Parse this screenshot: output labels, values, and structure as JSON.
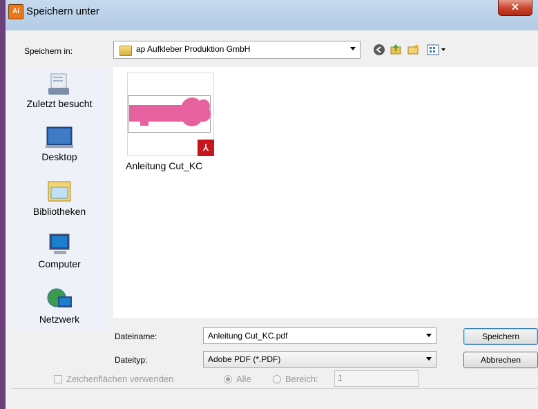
{
  "window": {
    "title": "Speichern unter",
    "app_icon_text": "Ai",
    "close_glyph": "✕"
  },
  "location": {
    "label": "Speichern in:",
    "value": "ap Aufkleber Produktion GmbH"
  },
  "toolbar": {
    "icons": [
      "back-icon",
      "up-folder-icon",
      "new-folder-icon",
      "view-menu-icon"
    ]
  },
  "places": [
    {
      "label": "Zuletzt besucht",
      "icon": "recent-places-icon"
    },
    {
      "label": "Desktop",
      "icon": "desktop-icon"
    },
    {
      "label": "Bibliotheken",
      "icon": "libraries-icon"
    },
    {
      "label": "Computer",
      "icon": "computer-icon"
    },
    {
      "label": "Netzwerk",
      "icon": "network-icon"
    }
  ],
  "files": [
    {
      "name": "Anleitung Cut_KC",
      "type": "pdf"
    }
  ],
  "filename": {
    "label": "Dateiname:",
    "value": "Anleitung Cut_KC.pdf"
  },
  "filetype": {
    "label": "Dateityp:",
    "value": "Adobe PDF (*.PDF)"
  },
  "buttons": {
    "save": "Speichern",
    "cancel": "Abbrechen"
  },
  "options": {
    "artboards_label": "Zeichenflächen verwenden",
    "all_label": "Alle",
    "range_label": "Bereich:",
    "range_value": "1"
  },
  "colors": {
    "accent": "#3c7fb1",
    "thumb_shape": "#e8619f",
    "pdf_badge": "#c8161d"
  }
}
